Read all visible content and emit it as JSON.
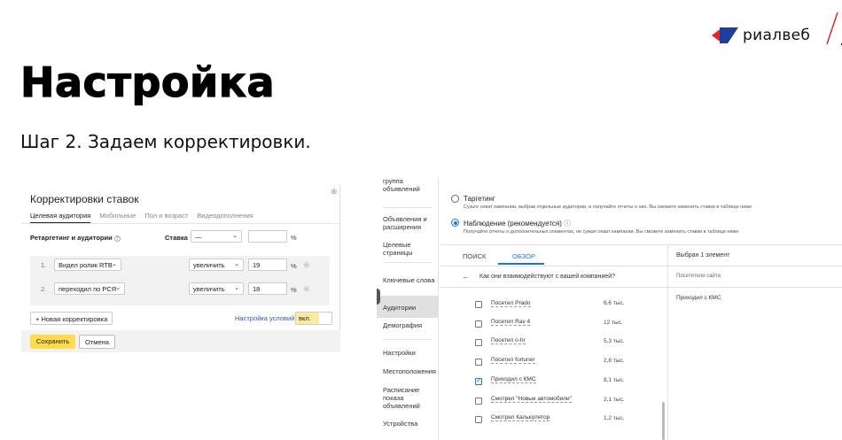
{
  "logo": {
    "text": "риалвеб",
    "colors": {
      "red": "#e3262b",
      "blue": "#1f3f9c"
    }
  },
  "header": {
    "title": "Настройка",
    "subtitle": "Шаг 2. Задаем корректировки."
  },
  "left_panel": {
    "title": "Корректировки ставок",
    "tabs": [
      "Целевая аудитория",
      "Мобильные",
      "Пол и возраст",
      "Видеодополнения"
    ],
    "retargeting_label": "Ретаргетинг и аудитории",
    "rate_label": "Ставка",
    "rate_value": "—",
    "rate_input": "",
    "percent": "%",
    "rows": [
      {
        "num": "1.",
        "segment": "Видел ролик RTB",
        "action": "увеличить",
        "value": "19"
      },
      {
        "num": "2.",
        "segment": "переходил по РСЯ",
        "action": "увеличить",
        "value": "18"
      }
    ],
    "add_button": "+ Новая корректировка",
    "conditions_link": "Настройка условий",
    "toggle_on": "вкл.",
    "save_button": "Сохранить",
    "cancel_button": "Отмена"
  },
  "right_panel": {
    "sidebar": [
      "группа объявлений",
      "Объявления и расширения",
      "Целевые страницы",
      "Ключевые слова",
      "Аудитории",
      "Демография",
      "Настройки",
      "Местоположения",
      "Расписание показа объявлений",
      "Устройства"
    ],
    "targeting_label": "Таргетинг",
    "targeting_desc": "Сузьте охват кампании, выбрав отдельные аудитории, и получайте отчеты о них. Вы сможете изменить ставки в таблице ниже.",
    "observation_label": "Наблюдение (рекомендуется)",
    "observation_desc": "Получайте отчеты о дополнительных элементах, не сужая охват кампании. Вы сможете изменить ставки в таблице ниже.",
    "tab_search": "ПОИСК",
    "tab_overview": "ОБЗОР",
    "question": "Как они взаимодействуют с вашей компанией?",
    "items": [
      {
        "label": "Посетил Prado",
        "count": "6,6 тыс.",
        "checked": false
      },
      {
        "label": "Посетил Rav 4",
        "count": "12 тыс.",
        "checked": false
      },
      {
        "label": "Посетил о-hr",
        "count": "5,3 тыс.",
        "checked": false
      },
      {
        "label": "Посетил fortuner",
        "count": "2,8 тыс.",
        "checked": false
      },
      {
        "label": "Приходил с КМС",
        "count": "8,1 тыс.",
        "checked": true
      },
      {
        "label": "Смотрел \"Новые автомобили\"",
        "count": "2,1 тыс.",
        "checked": false
      },
      {
        "label": "Смотрел Калькулятор",
        "count": "1,2 тыс.",
        "checked": false
      }
    ],
    "selected_header": "Выбран 1 элемент",
    "selected_sub": "Посетители сайта",
    "selected_item": "Приходил с КМС"
  }
}
